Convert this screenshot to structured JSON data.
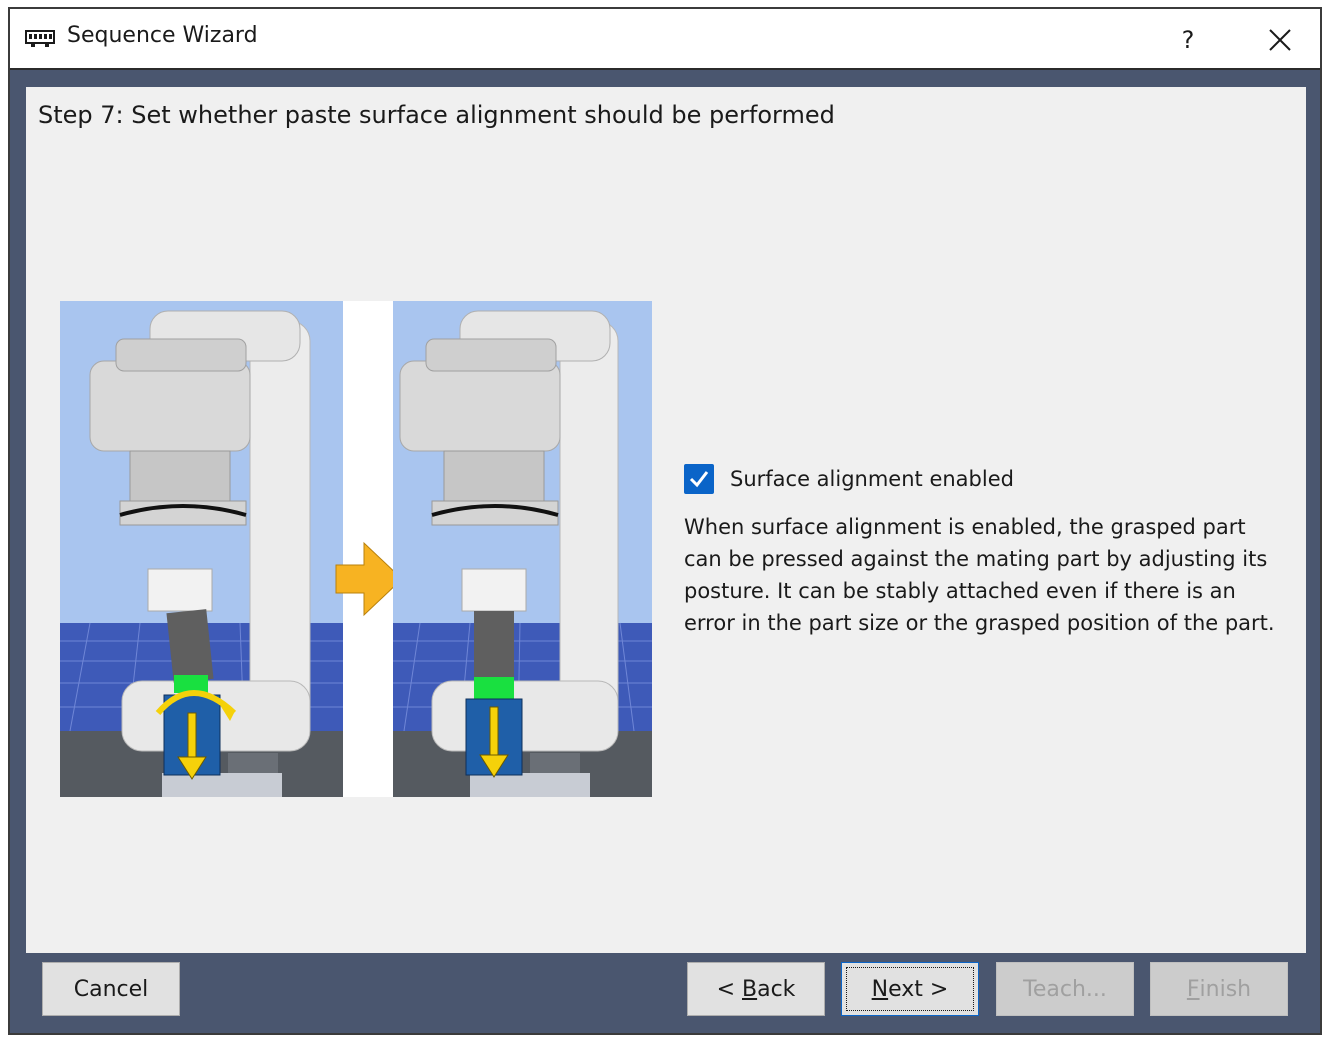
{
  "window": {
    "title": "Sequence Wizard",
    "help_label": "?"
  },
  "step": {
    "title": "Step 7: Set whether paste surface alignment should be performed"
  },
  "option": {
    "checkbox_label": "Surface alignment enabled",
    "checked": true,
    "description": "When surface alignment is enabled, the grasped part can be pressed against the mating part by adjusting its posture. It can be stably attached even if there is an error in the part size or the grasped position of the part."
  },
  "buttons": {
    "cancel": "Cancel",
    "back_prefix": "< ",
    "back_mnemonic": "B",
    "back_rest": "ack",
    "next_mnemonic": "N",
    "next_rest": "ext >",
    "teach": "Teach...",
    "finish_mnemonic": "F",
    "finish_rest": "inish"
  },
  "colors": {
    "frame": "#4a566f",
    "content_bg": "#f0f0f0",
    "checkbox": "#0a64c8",
    "sky": "#a8c4f0",
    "floor": "#3d57b3",
    "arrow": "#f7b322",
    "part": "#1f5fa8",
    "gripper_pad": "#19e040"
  }
}
